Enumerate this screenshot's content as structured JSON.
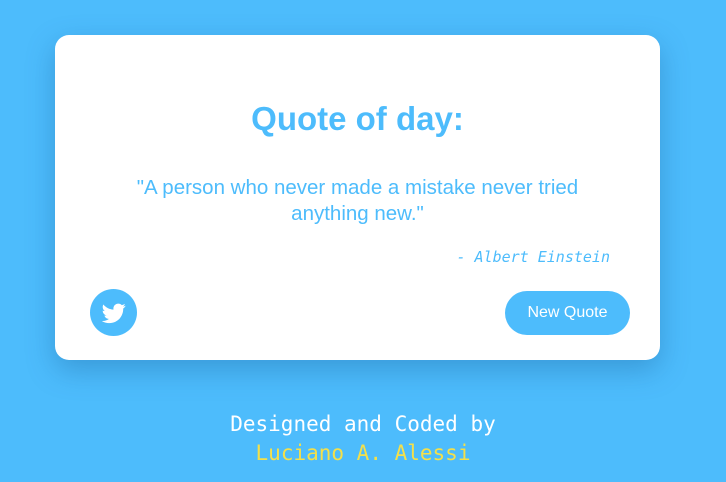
{
  "card": {
    "title": "Quote of day:",
    "quote": "\"A person who never made a mistake never tried anything new.\"",
    "author": "- Albert Einstein",
    "twitter_icon": "twitter-bird-icon",
    "new_quote_label": "New Quote"
  },
  "footer": {
    "designed_by": "Designed and Coded by",
    "author_name": "Luciano A. Alessi"
  },
  "colors": {
    "background": "#4dbcfc",
    "accent": "#4dbcfc",
    "card": "#ffffff",
    "footer_text": "#ffffff",
    "footer_name": "#f4e04a"
  }
}
